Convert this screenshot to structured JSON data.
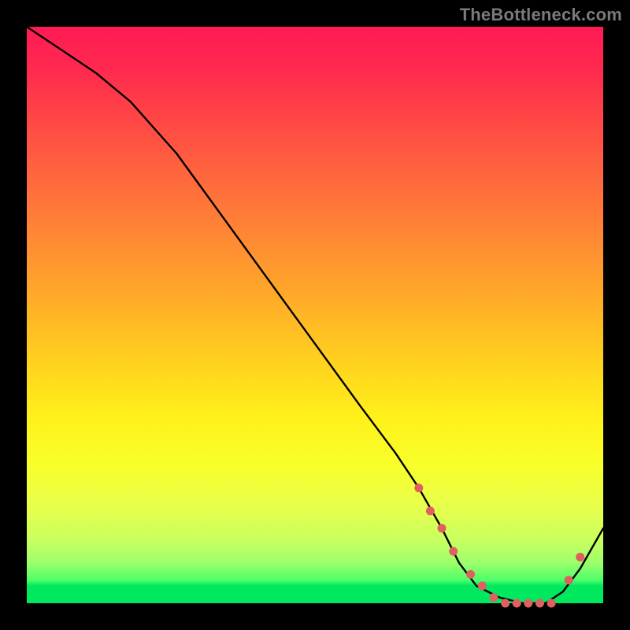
{
  "watermark": "TheBottleneck.com",
  "chart_data": {
    "type": "line",
    "title": "",
    "xlabel": "",
    "ylabel": "",
    "xlim": [
      0,
      100
    ],
    "ylim": [
      0,
      100
    ],
    "series": [
      {
        "name": "bottleneck-curve",
        "x": [
          0,
          6,
          12,
          18,
          26,
          34,
          42,
          50,
          58,
          64,
          68,
          72,
          75,
          78,
          82,
          86,
          90,
          93,
          96,
          100
        ],
        "y": [
          100,
          96,
          92,
          87,
          78,
          67,
          56,
          45,
          34,
          26,
          20,
          13,
          7,
          3,
          1,
          0,
          0,
          2,
          6,
          13
        ]
      }
    ],
    "markers": {
      "name": "highlight-dots",
      "color": "#e06060",
      "x": [
        68,
        70,
        72,
        74,
        77,
        79,
        81,
        83,
        85,
        87,
        89,
        91,
        94,
        96
      ],
      "y": [
        20,
        16,
        13,
        9,
        5,
        3,
        1,
        0,
        0,
        0,
        0,
        0,
        4,
        8
      ]
    },
    "background_gradient": {
      "top": "#ff1a55",
      "mid": "#ffd11e",
      "bottom": "#00e85e"
    }
  }
}
